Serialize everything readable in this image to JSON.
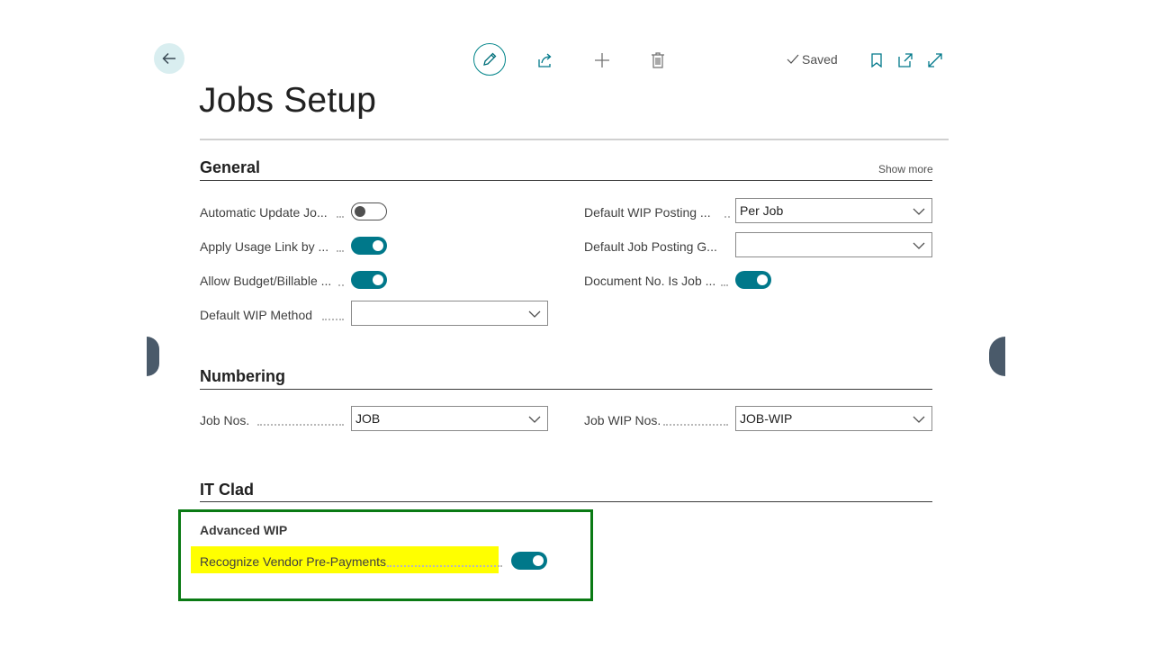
{
  "page": {
    "title": "Jobs Setup"
  },
  "toolbar": {
    "status": "Saved",
    "icons": [
      "back-arrow-icon",
      "pencil-icon",
      "share-icon",
      "plus-icon",
      "trash-icon",
      "checkmark-icon",
      "bookmark-icon",
      "open-new-window-icon",
      "expand-icon"
    ]
  },
  "general": {
    "title": "General",
    "show_more": "Show more",
    "fields": {
      "automatic_update": {
        "label": "Automatic Update Jo...",
        "value": false
      },
      "apply_usage_link": {
        "label": "Apply Usage Link by ...",
        "value": true
      },
      "allow_budget": {
        "label": "Allow Budget/Billable ...",
        "value": true
      },
      "default_wip_method": {
        "label": "Default WIP Method",
        "value": ""
      },
      "default_wip_posting": {
        "label": "Default WIP Posting ...",
        "value": "Per Job"
      },
      "default_job_posting": {
        "label": "Default Job Posting G...",
        "value": ""
      },
      "document_no_is_job": {
        "label": "Document No. Is Job ...",
        "value": true
      }
    }
  },
  "numbering": {
    "title": "Numbering",
    "fields": {
      "job_nos": {
        "label": "Job Nos.",
        "value": "JOB"
      },
      "job_wip_nos": {
        "label": "Job WIP Nos.",
        "value": "JOB-WIP"
      }
    }
  },
  "it_clad": {
    "title": "IT Clad",
    "group": {
      "title": "Advanced WIP",
      "recognize_vendor": {
        "label": "Recognize Vendor Pre-Payments",
        "value": true
      }
    }
  },
  "colors": {
    "accent": "#00788a",
    "highlight_yellow": "#ffff00",
    "highlight_border": "#0a7a14"
  }
}
